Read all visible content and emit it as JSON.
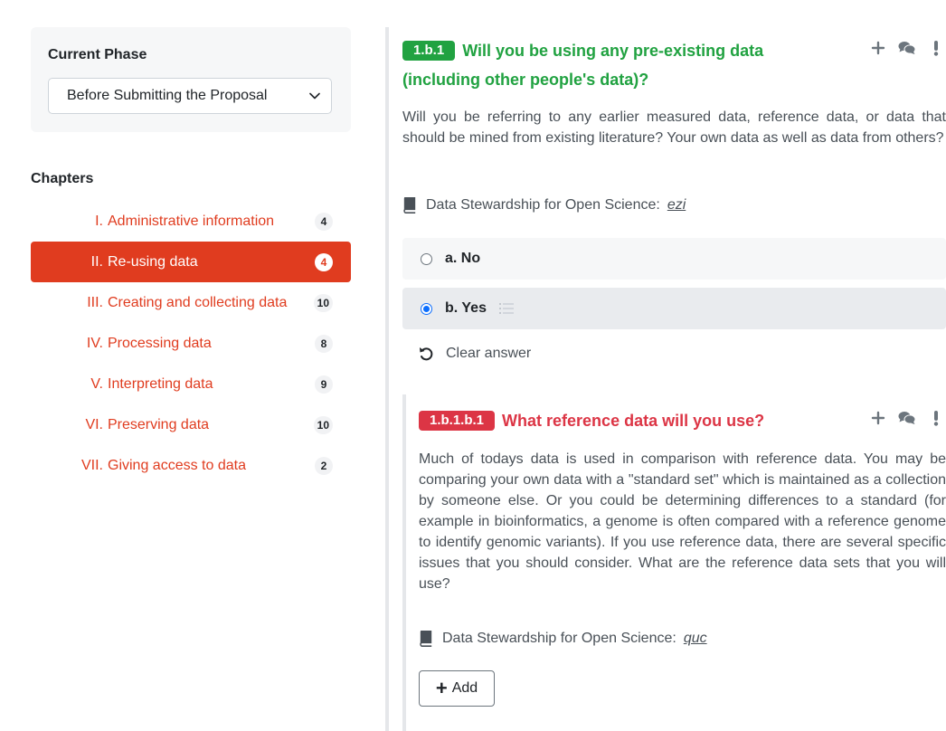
{
  "sidebar": {
    "phase_title": "Current Phase",
    "phase_value": "Before Submitting the Proposal",
    "chapters_title": "Chapters",
    "chapters": [
      {
        "roman": "I.",
        "label": "Administrative information",
        "count": "4",
        "active": false
      },
      {
        "roman": "II.",
        "label": "Re-using data",
        "count": "4",
        "active": true
      },
      {
        "roman": "III.",
        "label": "Creating and collecting data",
        "count": "10",
        "active": false
      },
      {
        "roman": "IV.",
        "label": "Processing data",
        "count": "8",
        "active": false
      },
      {
        "roman": "V.",
        "label": "Interpreting data",
        "count": "9",
        "active": false
      },
      {
        "roman": "VI.",
        "label": "Preserving data",
        "count": "10",
        "active": false
      },
      {
        "roman": "VII.",
        "label": "Giving access to data",
        "count": "2",
        "active": false
      }
    ]
  },
  "question": {
    "number": "1.b.1",
    "title_line1": "Will you be using any pre-existing data",
    "title_line2": "(including other people's data)?",
    "description": "Will you be referring to any earlier measured data, reference data, or data that should be mined from existing literature? Your own data as well as data from others?",
    "ref_label": "Data Stewardship for Open Science:",
    "ref_link": "ezi",
    "answers": [
      {
        "label": "a. No",
        "selected": false
      },
      {
        "label": "b. Yes",
        "selected": true
      }
    ],
    "clear_label": "Clear answer",
    "icons": [
      "plus-icon",
      "comments-icon",
      "exclamation-icon"
    ]
  },
  "subquestion": {
    "number": "1.b.1.b.1",
    "title": "What reference data will you use?",
    "description": "Much of todays data is used in comparison with reference data. You may be comparing your own data with a \"standard set\" which is maintained as a collection by someone else. Or you could be determining differences to a standard (for example in bioinformatics, a genome is often compared with a reference genome to identify genomic variants). If you use reference data, there are several specific issues that you should consider. What are the reference data sets that you will use?",
    "ref_label": "Data Stewardship for Open Science:",
    "ref_link": "quc",
    "add_label": "Add"
  },
  "colors": {
    "accent": "#e03c1f",
    "question_green": "#21a241",
    "subquestion_red": "#dc3545",
    "radio_blue": "#0d6efd"
  }
}
